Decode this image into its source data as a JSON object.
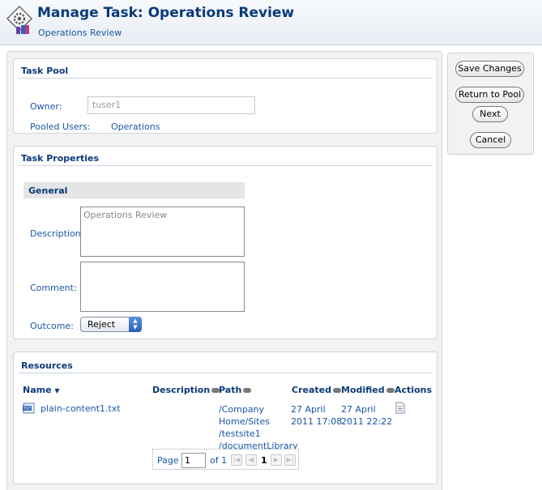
{
  "header": {
    "title": "Manage Task: Operations Review",
    "subtitle": "Operations Review"
  },
  "task_pool": {
    "title": "Task Pool",
    "owner_label": "Owner:",
    "owner_value": "tuser1",
    "pooled_users_label": "Pooled Users:",
    "pooled_users_value": "Operations"
  },
  "task_properties": {
    "title": "Task Properties",
    "general_title": "General",
    "description_label": "Description:",
    "description_value": "Operations Review",
    "comment_label": "Comment:",
    "comment_value": "",
    "outcome_label": "Outcome:",
    "outcome_value": "Reject"
  },
  "resources": {
    "title": "Resources",
    "columns": [
      "Name",
      "Description",
      "Path",
      "Created",
      "Modified",
      "Actions"
    ],
    "rows": [
      {
        "name": "plain-content1.txt",
        "description": "",
        "path_lines": [
          "/Company",
          "Home/Sites",
          "/testsite1",
          "/documentLibrary"
        ],
        "created_lines": [
          "27 April",
          "2011 17:08"
        ],
        "modified_lines": [
          "27 April",
          "2011 22:22"
        ]
      }
    ],
    "pager": {
      "page_label": "Page",
      "page_value": "1",
      "of_label": "of 1",
      "current_page": "1"
    }
  },
  "actions": {
    "save_changes": "Save Changes",
    "return_to_pool": "Return to Pool",
    "next": "Next",
    "cancel": "Cancel"
  },
  "icons": {
    "header": "task-gear-icon",
    "file": "txt-file-icon",
    "view_details": "document-details-icon"
  },
  "colors": {
    "title": "#0a3a7a",
    "link": "#1a56a6",
    "panel_bg": "#f2f2f2"
  }
}
